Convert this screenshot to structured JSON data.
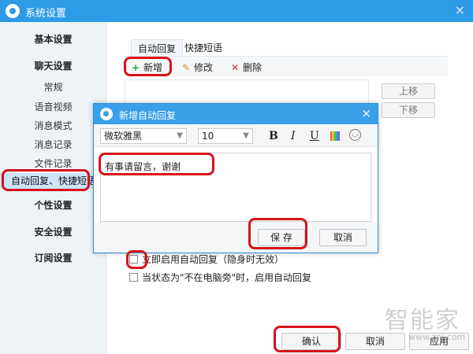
{
  "window": {
    "title": "系统设置",
    "close": "×"
  },
  "sidebar": {
    "items": [
      {
        "label": "基本设置",
        "style": "bold"
      },
      {
        "label": "聊天设置",
        "style": "bold"
      },
      {
        "label": "常规",
        "style": "sub"
      },
      {
        "label": "语音视频",
        "style": "sub"
      },
      {
        "label": "消息模式",
        "style": "sub"
      },
      {
        "label": "消息记录",
        "style": "sub"
      },
      {
        "label": "文件记录",
        "style": "sub"
      },
      {
        "label": "自动回复、快捷短语",
        "style": "active"
      },
      {
        "label": "个性设置",
        "style": "bold"
      },
      {
        "label": "安全设置",
        "style": "bold"
      },
      {
        "label": "订阅设置",
        "style": "bold"
      }
    ]
  },
  "tabs": [
    {
      "label": "自动回复",
      "active": true
    },
    {
      "label": "快捷短语",
      "active": false
    }
  ],
  "toolbar": {
    "add": {
      "icon": "plus-icon",
      "label": "新增"
    },
    "edit": {
      "icon": "pencil-icon",
      "label": "修改"
    },
    "delete": {
      "icon": "x-icon",
      "label": "删除"
    }
  },
  "side_buttons": {
    "move_up": "上移",
    "move_down": "下移"
  },
  "options": {
    "auto_reply_now": "立即启用自动回复（隐身时无效）",
    "away_auto_reply": "当状态为\"不在电脑旁\"时，启用自动回复"
  },
  "footer": {
    "confirm": "确认",
    "cancel": "取消",
    "apply": "应用"
  },
  "dialog": {
    "title": "新增自动回复",
    "close": "×",
    "font_name": "微软雅黑",
    "font_size": "10",
    "format_bold": "B",
    "format_italic": "I",
    "format_underline": "U",
    "message": "有事请留言，谢谢",
    "save": "保 存",
    "cancel": "取消"
  },
  "watermark": {
    "main": "智能家",
    "sub": "www.znj.com"
  },
  "colors": {
    "title_bar": "#2e9be6",
    "highlight": "#d8121b",
    "active_item": "#cde4f8"
  }
}
